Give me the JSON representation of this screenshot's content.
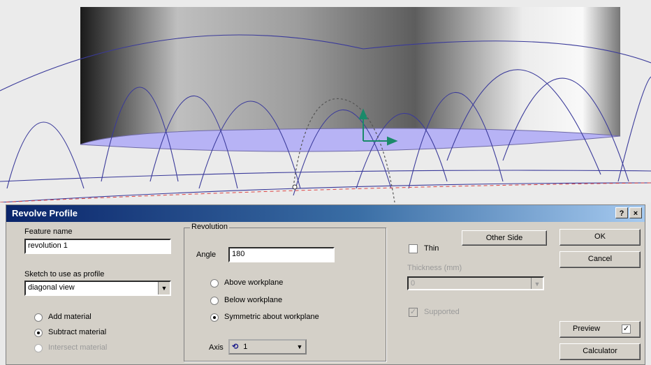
{
  "dialog": {
    "title": "Revolve Profile",
    "help_label": "?",
    "close_label": "×",
    "feature_name_label": "Feature name",
    "feature_name_value": "revolution 1",
    "sketch_label": "Sketch to use as profile",
    "sketch_value": "diagonal view",
    "material": {
      "add": "Add material",
      "subtract": "Subtract material",
      "intersect": "Intersect material",
      "selected": "subtract"
    },
    "revolution": {
      "group_label": "Revolution",
      "angle_label": "Angle",
      "angle_value": "180",
      "above": "Above workplane",
      "below": "Below workplane",
      "symmetric": "Symmetric about workplane",
      "selected": "symmetric",
      "axis_label": "Axis",
      "axis_value": "1"
    },
    "other_side_label": "Other Side",
    "thin_label": "Thin",
    "thickness_label": "Thickness (mm)",
    "thickness_value": "0",
    "supported_label": "Supported",
    "ok_label": "OK",
    "cancel_label": "Cancel",
    "preview_label": "Preview",
    "preview_checked": "✓",
    "calculator_label": "Calculator"
  },
  "colors": {
    "wire": "#3a3a9a",
    "surface": "#b7b3f5",
    "dashed": "#d44",
    "axis": "#1a8a6a",
    "title_start": "#0a246a"
  }
}
